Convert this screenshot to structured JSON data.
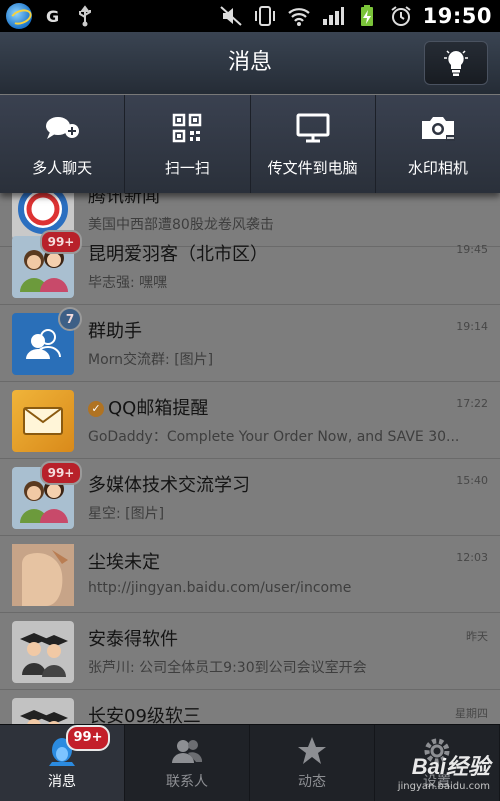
{
  "status_bar": {
    "carrier_glyph": "G",
    "time": "19:50"
  },
  "header": {
    "title": "消息"
  },
  "menu": {
    "items": [
      {
        "label": "多人聊天",
        "icon": "group-chat-icon"
      },
      {
        "label": "扫一扫",
        "icon": "qr-code-icon"
      },
      {
        "label": "传文件到电脑",
        "icon": "monitor-icon"
      },
      {
        "label": "水印相机",
        "icon": "camera-icon"
      }
    ]
  },
  "conversations": [
    {
      "name": "腾讯新闻",
      "preview": "美国中西部遭80股龙卷风袭击",
      "time": ""
    },
    {
      "name": "昆明爱羽客（北市区）",
      "preview": "毕志强: 嘿嘿",
      "time": "19:45",
      "badge": "99+"
    },
    {
      "name": "群助手",
      "preview": "Morn交流群: [图片]",
      "time": "19:14",
      "badge": "7"
    },
    {
      "name": "QQ邮箱提醒",
      "preview": "GoDaddy：Complete Your Order Now, and SAVE 30...",
      "time": "17:22"
    },
    {
      "name": "多媒体技术交流学习",
      "preview": "星空: [图片]",
      "time": "15:40",
      "badge": "99+"
    },
    {
      "name": "尘埃未定",
      "preview": "http://jingyan.baidu.com/user/income",
      "time": "12:03"
    },
    {
      "name": "安泰得软件",
      "preview": "张芦川: 公司全体员工9:30到公司会议室开会",
      "time": "昨天"
    },
    {
      "name": "长安09级软三",
      "preview": "",
      "time": "星期四"
    }
  ],
  "bottom_nav": {
    "items": [
      {
        "label": "消息",
        "badge": "99+",
        "active": true
      },
      {
        "label": "联系人"
      },
      {
        "label": "动态"
      },
      {
        "label": "设置"
      }
    ]
  },
  "watermark": {
    "main": "Bai经验",
    "sub": "jingyan.baidu.com"
  }
}
